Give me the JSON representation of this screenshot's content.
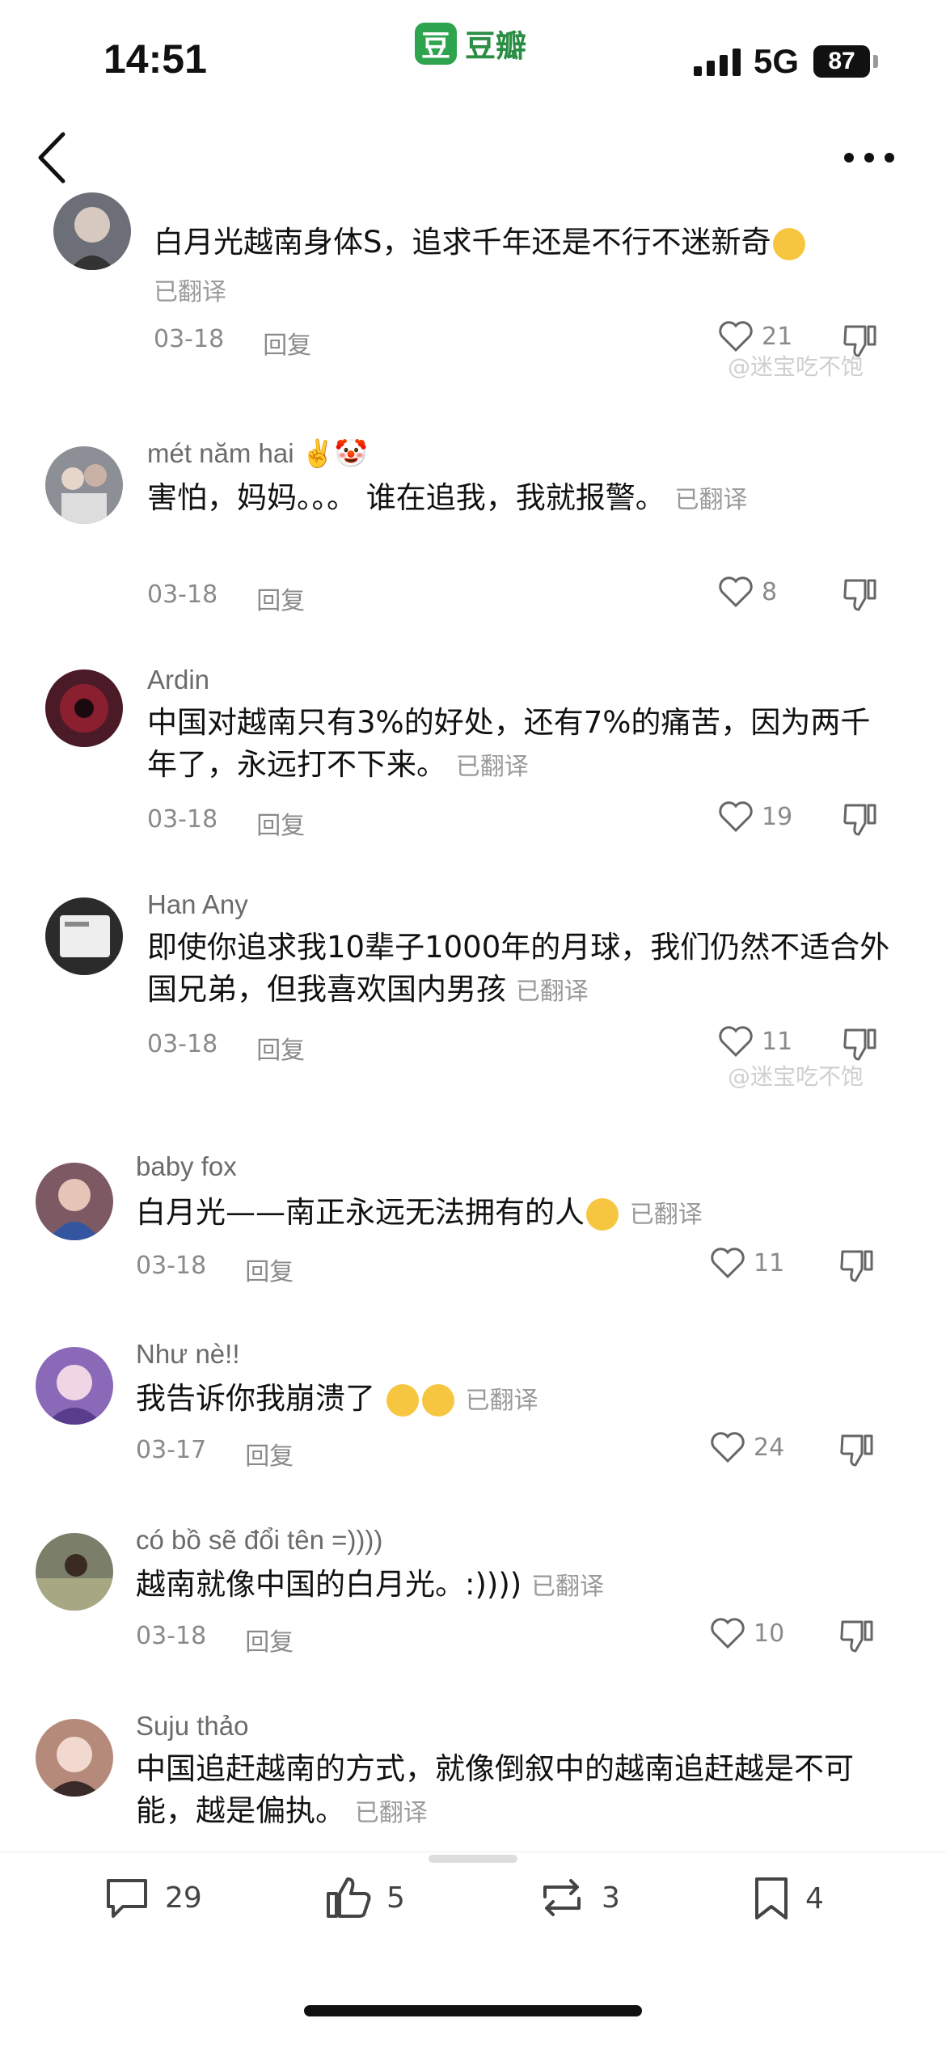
{
  "status_bar": {
    "time": "14:51",
    "app_logo_char": "豆",
    "app_name": "豆瓣",
    "network": "5G",
    "battery": "87"
  },
  "comments": [
    {
      "username": "",
      "text": "白月光越南身体S，追求千年还是不行不迷新奇",
      "translated": "已翻译",
      "date": "03-18",
      "reply": "回复",
      "likes": "21",
      "avatar_color": "#6d6f78"
    },
    {
      "username": "mét năm hai ✌️🤡",
      "text": "害怕，妈妈。。。 谁在追我，我就报警。",
      "translated": "已翻译",
      "date": "03-18",
      "reply": "回复",
      "likes": "8",
      "avatar_color": "#8c8f96"
    },
    {
      "username": "Ardin",
      "text": "中国对越南只有3%的好处，还有7%的痛苦，因为两千年了，永远打不下来。",
      "translated": "已翻译",
      "date": "03-18",
      "reply": "回复",
      "likes": "19",
      "avatar_color": "#4a1a26"
    },
    {
      "username": "Han Any",
      "text": "即使你追求我10辈子1000年的月球，我们仍然不适合外国兄弟，但我喜欢国内男孩",
      "translated": "已翻译",
      "date": "03-18",
      "reply": "回复",
      "likes": "11",
      "avatar_color": "#2b2b2b"
    },
    {
      "username": "baby fox",
      "text": "白月光——南正永远无法拥有的人",
      "translated": "已翻译",
      "date": "03-18",
      "reply": "回复",
      "likes": "11",
      "avatar_color": "#7d5a63"
    },
    {
      "username": "Như nè!!",
      "text": "我告诉你我崩溃了",
      "translated": "已翻译",
      "date": "03-17",
      "reply": "回复",
      "likes": "24",
      "avatar_color": "#8a6ab8"
    },
    {
      "username": "có bồ sẽ đổi tên =))))",
      "text": "越南就像中国的白月光。:))))",
      "translated": "已翻译",
      "date": "03-18",
      "reply": "回复",
      "likes": "10",
      "avatar_color": "#7b7f6a"
    },
    {
      "username": "Suju thảo",
      "text": "中国追赶越南的方式，就像倒叙中的越南追赶越是不可能，越是偏执。",
      "translated": "已翻译",
      "date": "",
      "reply": "",
      "likes": "",
      "avatar_color": "#b58a7a"
    }
  ],
  "watermarks": [
    "@迷宝吃不饱",
    "@迷宝吃不饱"
  ],
  "bottom_bar": {
    "comments": "29",
    "likes": "5",
    "reposts": "3",
    "bookmarks": "4"
  },
  "icons": [
    "back-icon",
    "more-icon",
    "heart-icon",
    "dislike-icon",
    "comment-icon",
    "thumb-up-icon",
    "repost-icon",
    "bookmark-icon"
  ]
}
